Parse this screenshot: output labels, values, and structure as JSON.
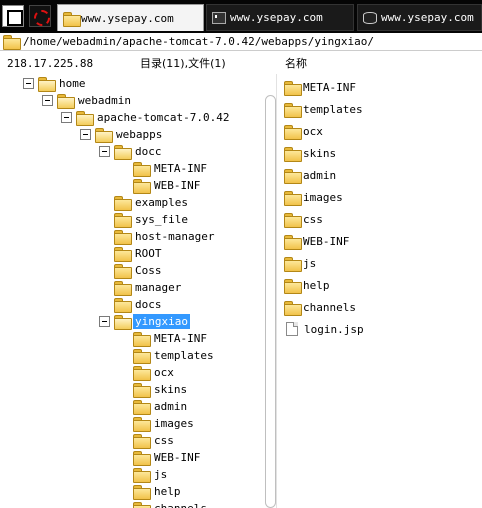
{
  "tabs": [
    {
      "label": "www.ysepay.com",
      "icon": "folder-icon",
      "active": true
    },
    {
      "label": "www.ysepay.com",
      "icon": "terminal-icon",
      "active": false
    },
    {
      "label": "www.ysepay.com",
      "icon": "database-icon",
      "active": false
    }
  ],
  "path": "/home/webadmin/apache-tomcat-7.0.42/webapps/yingxiao/",
  "header": {
    "ip": "218.17.225.88",
    "count": "目录(11),文件(1)",
    "name_col": "名称"
  },
  "tree": [
    {
      "label": "home",
      "expanded": true
    },
    {
      "label": "webadmin",
      "expanded": true
    },
    {
      "label": "apache-tomcat-7.0.42",
      "expanded": true
    },
    {
      "label": "webapps",
      "expanded": true
    },
    {
      "label": "docc",
      "expanded": true
    },
    {
      "label": "META-INF"
    },
    {
      "label": "WEB-INF"
    },
    {
      "label": "examples"
    },
    {
      "label": "sys_file"
    },
    {
      "label": "host-manager"
    },
    {
      "label": "ROOT"
    },
    {
      "label": "Coss"
    },
    {
      "label": "manager"
    },
    {
      "label": "docs"
    },
    {
      "label": "yingxiao",
      "expanded": true,
      "selected": true
    },
    {
      "label": "META-INF"
    },
    {
      "label": "templates"
    },
    {
      "label": "ocx"
    },
    {
      "label": "skins"
    },
    {
      "label": "admin"
    },
    {
      "label": "images"
    },
    {
      "label": "css"
    },
    {
      "label": "WEB-INF"
    },
    {
      "label": "js"
    },
    {
      "label": "help"
    },
    {
      "label": "channels"
    }
  ],
  "files": [
    {
      "name": "META-INF",
      "type": "folder"
    },
    {
      "name": "templates",
      "type": "folder"
    },
    {
      "name": "ocx",
      "type": "folder"
    },
    {
      "name": "skins",
      "type": "folder"
    },
    {
      "name": "admin",
      "type": "folder"
    },
    {
      "name": "images",
      "type": "folder"
    },
    {
      "name": "css",
      "type": "folder"
    },
    {
      "name": "WEB-INF",
      "type": "folder"
    },
    {
      "name": "js",
      "type": "folder"
    },
    {
      "name": "help",
      "type": "folder"
    },
    {
      "name": "channels",
      "type": "folder"
    },
    {
      "name": "login.jsp",
      "type": "file"
    }
  ],
  "colors": {
    "selection": "#3399ff",
    "tabbar": "#050505",
    "folder": "#f1c24a"
  }
}
